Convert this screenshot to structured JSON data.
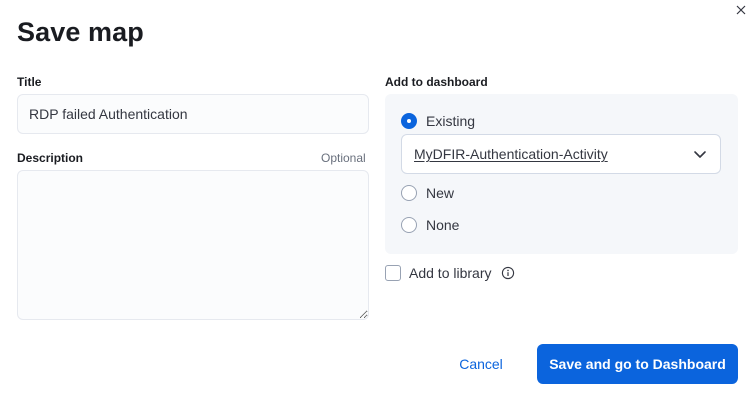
{
  "modal": {
    "title": "Save map",
    "close_icon": "close-icon"
  },
  "form": {
    "title_label": "Title",
    "title_value": "RDP failed Authentication",
    "description_label": "Description",
    "description_optional": "Optional",
    "description_value": ""
  },
  "dashboard": {
    "label": "Add to dashboard",
    "options": [
      {
        "label": "Existing",
        "checked": true
      },
      {
        "label": "New",
        "checked": false
      },
      {
        "label": "None",
        "checked": false
      }
    ],
    "selected_dashboard": "MyDFIR-Authentication-Activity",
    "chevron_icon": "chevron-down-icon"
  },
  "library": {
    "label": "Add to library",
    "checked": false,
    "info_icon": "info-icon"
  },
  "footer": {
    "cancel_label": "Cancel",
    "save_label": "Save and go to Dashboard"
  },
  "colors": {
    "primary": "#0b64dd",
    "panel_bg": "#f5f7fa",
    "text": "#343741"
  }
}
